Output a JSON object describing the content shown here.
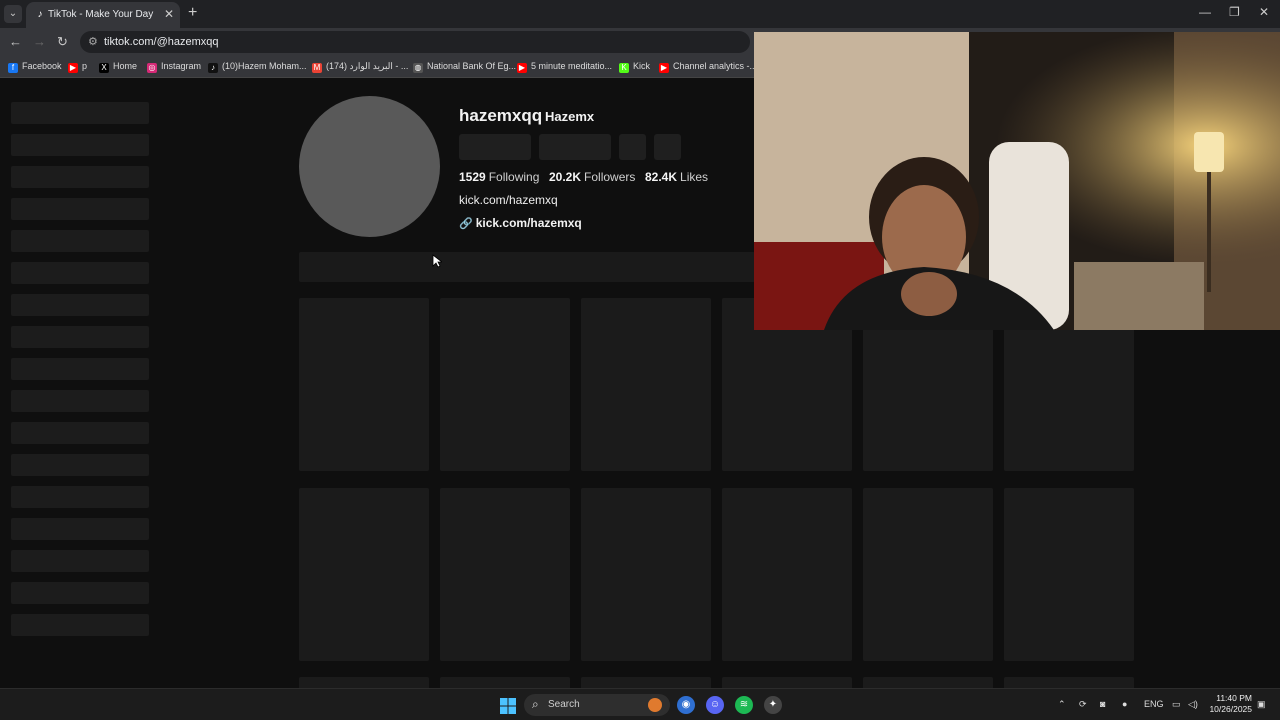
{
  "browser": {
    "tab_title": "TikTok - Make Your Day",
    "url": "tiktok.com/@hazemxqq",
    "bookmarks": [
      {
        "label": "Facebook",
        "icon": "facebook-icon",
        "color": "#1877f2"
      },
      {
        "label": "p",
        "icon": "youtube-icon",
        "color": "#ff0000"
      },
      {
        "label": "Home",
        "icon": "x-icon",
        "color": "#000000"
      },
      {
        "label": "Instagram",
        "icon": "instagram-icon",
        "color": "#d62976"
      },
      {
        "label": "(10)Hazem Moham...",
        "icon": "tiktok-icon",
        "color": "#111111"
      },
      {
        "label": "(174) البريد الوارد - ...",
        "icon": "gmail-icon",
        "color": "#ea4335"
      },
      {
        "label": "National Bank Of Eg...",
        "icon": "globe-icon",
        "color": "#555555"
      },
      {
        "label": "5 minute meditatio...",
        "icon": "youtube-icon",
        "color": "#ff0000"
      },
      {
        "label": "Kick",
        "icon": "kick-icon",
        "color": "#53fc18"
      },
      {
        "label": "Channel analytics -...",
        "icon": "youtube-icon",
        "color": "#ff0000"
      }
    ]
  },
  "profile": {
    "username": "hazemxqq",
    "nickname": "Hazemx",
    "following_count": "1529",
    "following_label": "Following",
    "followers_count": "20.2K",
    "followers_label": "Followers",
    "likes_count": "82.4K",
    "likes_label": "Likes",
    "bio": "kick.com/hazemxq",
    "link": "kick.com/hazemxq"
  },
  "taskbar": {
    "search_label": "Search",
    "language": "ENG",
    "time": "11:40 PM",
    "date": "10/26/2025"
  },
  "colors": {
    "page_bg": "#0f0f0f",
    "skeleton": "#1b1b1b",
    "chrome": "#35363a"
  }
}
